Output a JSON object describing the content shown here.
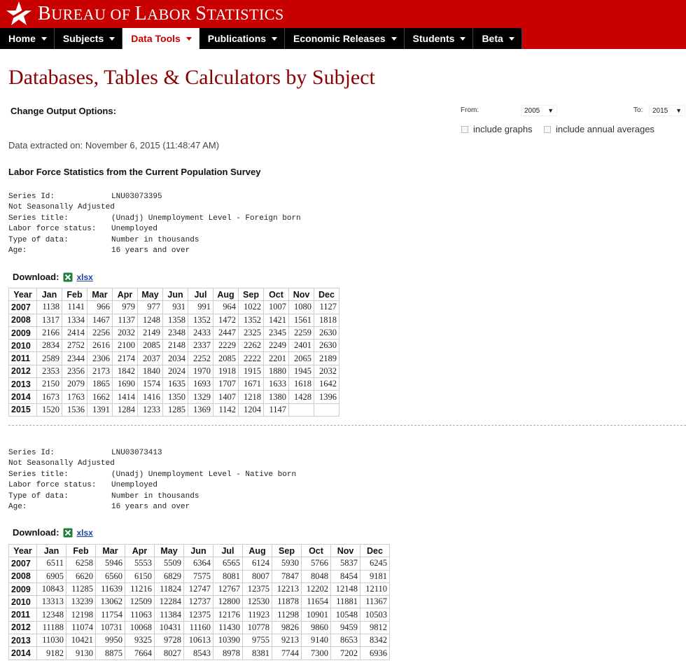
{
  "header": {
    "title_initial_1": "B",
    "title_rest_1": "UREAU OF ",
    "title_initial_2": "L",
    "title_rest_2": "ABOR ",
    "title_initial_3": "S",
    "title_rest_3": "TATISTICS"
  },
  "nav": {
    "items": [
      "Home",
      "Subjects",
      "Data Tools",
      "Publications",
      "Economic Releases",
      "Students",
      "Beta"
    ],
    "active": "Data Tools"
  },
  "colors": {
    "brand_red": "#c80000",
    "title_red": "#8b0000",
    "link_blue": "#1a3fa8"
  },
  "page_title": "Databases, Tables & Calculators by Subject",
  "options": {
    "label": "Change Output Options:",
    "from_label": "From:",
    "from_value": "2005",
    "to_label": "To:",
    "to_value": "2015",
    "include_graphs": "include graphs",
    "include_annual": "include annual averages"
  },
  "extracted": "Data extracted on: November 6, 2015 (11:48:47 AM)",
  "survey_title": "Labor Force Statistics from the Current Population Survey",
  "download": {
    "label": "Download:",
    "link": "xlsx"
  },
  "months": [
    "Year",
    "Jan",
    "Feb",
    "Mar",
    "Apr",
    "May",
    "Jun",
    "Jul",
    "Aug",
    "Sep",
    "Oct",
    "Nov",
    "Dec"
  ],
  "series": [
    {
      "series_id_label": "Series Id:",
      "series_id": "LNU03073395",
      "adjustment": "Not Seasonally Adjusted",
      "title_label": "Series title:",
      "title": "(Unadj) Unemployment Level - Foreign born",
      "status_label": "Labor force status:",
      "status": "Unemployed",
      "type_label": "Type of data:",
      "type": "Number in thousands",
      "age_label": "Age:",
      "age": "16 years and over",
      "rows": [
        [
          "2007",
          "1138",
          "1141",
          "966",
          "979",
          "977",
          "931",
          "991",
          "964",
          "1022",
          "1007",
          "1080",
          "1127"
        ],
        [
          "2008",
          "1317",
          "1334",
          "1467",
          "1137",
          "1248",
          "1358",
          "1352",
          "1472",
          "1352",
          "1421",
          "1561",
          "1818"
        ],
        [
          "2009",
          "2166",
          "2414",
          "2256",
          "2032",
          "2149",
          "2348",
          "2433",
          "2447",
          "2325",
          "2345",
          "2259",
          "2630"
        ],
        [
          "2010",
          "2834",
          "2752",
          "2616",
          "2100",
          "2085",
          "2148",
          "2337",
          "2229",
          "2262",
          "2249",
          "2401",
          "2630"
        ],
        [
          "2011",
          "2589",
          "2344",
          "2306",
          "2174",
          "2037",
          "2034",
          "2252",
          "2085",
          "2222",
          "2201",
          "2065",
          "2189"
        ],
        [
          "2012",
          "2353",
          "2356",
          "2173",
          "1842",
          "1840",
          "2024",
          "1970",
          "1918",
          "1915",
          "1880",
          "1945",
          "2032"
        ],
        [
          "2013",
          "2150",
          "2079",
          "1865",
          "1690",
          "1574",
          "1635",
          "1693",
          "1707",
          "1671",
          "1633",
          "1618",
          "1642"
        ],
        [
          "2014",
          "1673",
          "1763",
          "1662",
          "1414",
          "1416",
          "1350",
          "1329",
          "1407",
          "1218",
          "1380",
          "1428",
          "1396"
        ],
        [
          "2015",
          "1520",
          "1536",
          "1391",
          "1284",
          "1233",
          "1285",
          "1369",
          "1142",
          "1204",
          "1147",
          "",
          ""
        ]
      ]
    },
    {
      "series_id_label": "Series Id:",
      "series_id": "LNU03073413",
      "adjustment": "Not Seasonally Adjusted",
      "title_label": "Series title:",
      "title": "(Unadj) Unemployment Level - Native born",
      "status_label": "Labor force status:",
      "status": "Unemployed",
      "type_label": "Type of data:",
      "type": "Number in thousands",
      "age_label": "Age:",
      "age": "16 years and over",
      "rows": [
        [
          "2007",
          "6511",
          "6258",
          "5946",
          "5553",
          "5509",
          "6364",
          "6565",
          "6124",
          "5930",
          "5766",
          "5837",
          "6245"
        ],
        [
          "2008",
          "6905",
          "6620",
          "6560",
          "6150",
          "6829",
          "7575",
          "8081",
          "8007",
          "7847",
          "8048",
          "8454",
          "9181"
        ],
        [
          "2009",
          "10843",
          "11285",
          "11639",
          "11216",
          "11824",
          "12747",
          "12767",
          "12375",
          "12213",
          "12202",
          "12148",
          "12110"
        ],
        [
          "2010",
          "13313",
          "13239",
          "13062",
          "12509",
          "12284",
          "12737",
          "12800",
          "12530",
          "11878",
          "11654",
          "11881",
          "11367"
        ],
        [
          "2011",
          "12348",
          "12198",
          "11754",
          "11063",
          "11384",
          "12375",
          "12176",
          "11923",
          "11298",
          "10901",
          "10548",
          "10503"
        ],
        [
          "2012",
          "11188",
          "11074",
          "10731",
          "10068",
          "10431",
          "11160",
          "11430",
          "10778",
          "9826",
          "9860",
          "9459",
          "9812"
        ],
        [
          "2013",
          "11030",
          "10421",
          "9950",
          "9325",
          "9728",
          "10613",
          "10390",
          "9755",
          "9213",
          "9140",
          "8653",
          "8342"
        ],
        [
          "2014",
          "9182",
          "9130",
          "8875",
          "7664",
          "8027",
          "8543",
          "8978",
          "8381",
          "7744",
          "7300",
          "7202",
          "6936"
        ]
      ]
    }
  ]
}
